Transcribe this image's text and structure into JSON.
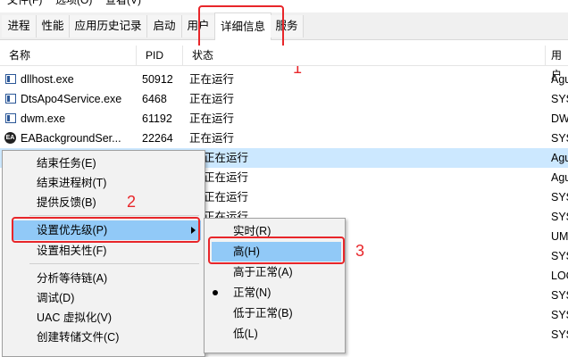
{
  "menu_top": [
    "文件(F)",
    "选项(O)",
    "查看(V)"
  ],
  "tabs": [
    "进程",
    "性能",
    "应用历史记录",
    "启动",
    "用户",
    "详细信息",
    "服务"
  ],
  "columns": [
    "名称",
    "PID",
    "状态",
    "用户"
  ],
  "rows": [
    {
      "name": "dllhost.exe",
      "pid": "50912",
      "status": "正在运行",
      "user": "Agu"
    },
    {
      "name": "DtsApo4Service.exe",
      "pid": "6468",
      "status": "正在运行",
      "user": "SYS"
    },
    {
      "name": "dwm.exe",
      "pid": "61192",
      "status": "正在运行",
      "user": "DW"
    },
    {
      "name": "EABackgroundSer...",
      "pid": "22264",
      "status": "正在运行",
      "user": "SYS"
    },
    {
      "name": "",
      "pid": "",
      "status": "正在运行",
      "user": "Agu"
    },
    {
      "name": "",
      "pid": "",
      "status": "正在运行",
      "user": "Agu"
    },
    {
      "name": "",
      "pid": "",
      "status": "正在运行",
      "user": "SYS"
    },
    {
      "name": "",
      "pid": "",
      "status": "正在运行",
      "user": "SYS"
    },
    {
      "name": "",
      "pid": "",
      "status": "",
      "user": "UM"
    },
    {
      "name": "",
      "pid": "",
      "status": "",
      "user": "SYS"
    },
    {
      "name": "",
      "pid": "",
      "status": "",
      "user": "LOC"
    },
    {
      "name": "",
      "pid": "",
      "status": "",
      "user": "SYS"
    },
    {
      "name": "",
      "pid": "",
      "status": "",
      "user": "SYS"
    },
    {
      "name": "",
      "pid": "",
      "status": "",
      "user": "SYS"
    }
  ],
  "context_menu": [
    "结束任务(E)",
    "结束进程树(T)",
    "提供反馈(B)",
    "设置优先级(P)",
    "设置相关性(F)",
    "分析等待链(A)",
    "调试(D)",
    "UAC 虚拟化(V)",
    "创建转储文件(C)"
  ],
  "priority_menu": [
    "实时(R)",
    "高(H)",
    "高于正常(A)",
    "正常(N)",
    "低于正常(B)",
    "低(L)"
  ],
  "annotations": [
    "1",
    "2",
    "3"
  ],
  "colors": {
    "annotation_red": "#e8262a",
    "selection_blue": "#cce8ff",
    "menu_highlight": "#91c9f7"
  }
}
